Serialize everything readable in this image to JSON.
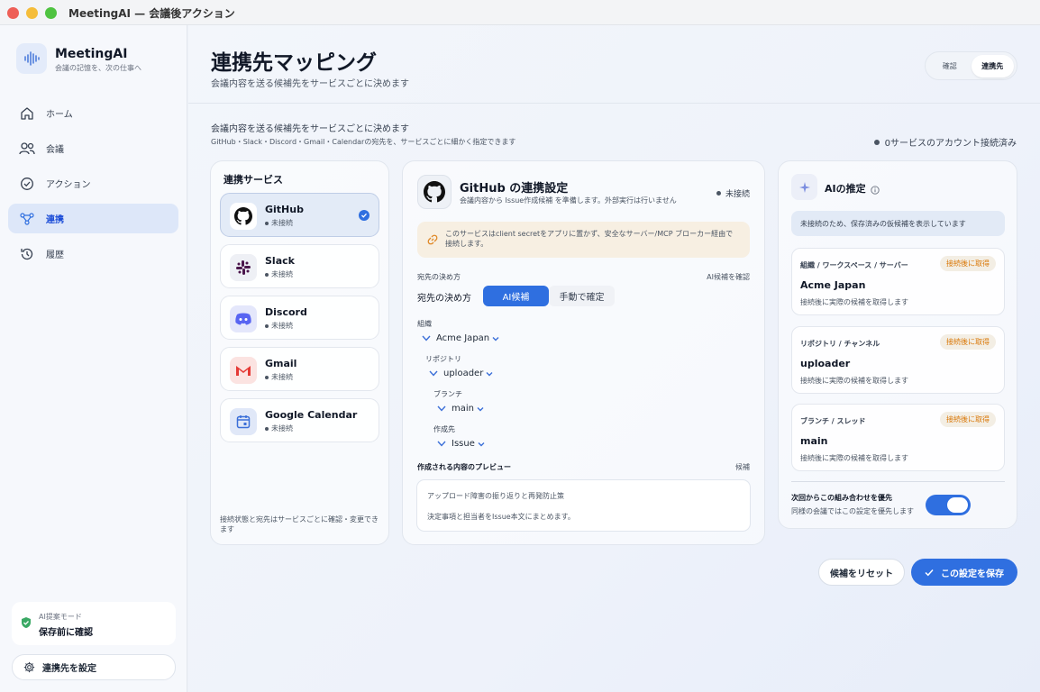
{
  "window": {
    "title": "MeetingAI — 会議後アクション"
  },
  "sidebar": {
    "app_name": "MeetingAI",
    "app_tagline": "会議の記憶を、次の仕事へ",
    "nav": [
      {
        "label": "ホーム",
        "icon": "home-icon"
      },
      {
        "label": "会議",
        "icon": "people-icon"
      },
      {
        "label": "アクション",
        "icon": "check-circle-icon"
      },
      {
        "label": "連携",
        "icon": "link-nodes-icon"
      },
      {
        "label": "履歴",
        "icon": "history-icon"
      }
    ],
    "active_nav": "連携",
    "mode_label": "AI提案モード",
    "mode_value": "保存前に確認",
    "config_button": "連携先を設定"
  },
  "header": {
    "title": "連携先マッピング",
    "subtitle": "会議内容を送る候補先をサービスごとに決めます",
    "tabs": [
      "確認",
      "連携先"
    ],
    "active_tab": "連携先"
  },
  "section": {
    "title": "会議内容を送る候補先をサービスごとに決めます",
    "description": "GitHub・Slack・Discord・Gmail・Calendarの宛先を、サービスごとに細かく指定できます",
    "connection_count": "0サービスのアカウント接続済み"
  },
  "services": {
    "title": "連携サービス",
    "items": [
      {
        "name": "GitHub",
        "status": "未接続",
        "icon": "github-icon",
        "selected": true
      },
      {
        "name": "Slack",
        "status": "未接続",
        "icon": "slack-icon",
        "selected": false
      },
      {
        "name": "Discord",
        "status": "未接続",
        "icon": "discord-icon",
        "selected": false
      },
      {
        "name": "Gmail",
        "status": "未接続",
        "icon": "gmail-icon",
        "selected": false
      },
      {
        "name": "Google Calendar",
        "status": "未接続",
        "icon": "calendar-icon",
        "selected": false
      }
    ],
    "footer": "接続状態と宛先はサービスごとに確認・変更できます"
  },
  "config": {
    "title": "GitHub の連携設定",
    "subtitle": "会議内容から Issue作成候補 を準備します。外部実行は行いません",
    "state": "未接続",
    "warning": "このサービスはclient secretをアプリに置かず、安全なサーバー/MCP ブローカー経由で接続します。",
    "dest_section_label": "宛先の決め方",
    "dest_section_right": "AI候補を確認",
    "dest_row_label": "宛先の決め方",
    "mode_ai": "AI候補",
    "mode_manual": "手動で確定",
    "org_label": "組織",
    "org_value": "Acme Japan",
    "repo_label": "リポジトリ",
    "repo_value": "uploader",
    "branch_label": "ブランチ",
    "branch_value": "main",
    "target_label": "作成先",
    "target_value": "Issue",
    "preview_title": "作成される内容のプレビュー",
    "preview_right": "候補",
    "preview_line1": "アップロード障害の振り返りと再発防止策",
    "preview_line2": "決定事項と担当者をIssue本文にまとめます。"
  },
  "ai": {
    "title": "AIの推定",
    "note": "未接続のため、保存済みの仮候補を表示しています",
    "candidates": [
      {
        "label": "組織 / ワークスペース / サーバー",
        "badge": "接続後に取得",
        "value": "Acme Japan",
        "note": "接続後に実際の候補を取得します"
      },
      {
        "label": "リポジトリ / チャンネル",
        "badge": "接続後に取得",
        "value": "uploader",
        "note": "接続後に実際の候補を取得します"
      },
      {
        "label": "ブランチ / スレッド",
        "badge": "接続後に取得",
        "value": "main",
        "note": "接続後に実際の候補を取得します"
      }
    ],
    "prioritize_title": "次回からこの組み合わせを優先",
    "prioritize_sub": "同様の会議ではこの設定を優先します",
    "prioritize_on": true
  },
  "actions": {
    "reset": "候補をリセット",
    "save": "この設定を保存"
  },
  "colors": {
    "accent": "#2f6fe0",
    "warning_badge": "#d97706",
    "gmail_red": "#e53935",
    "slack_purple": "#4a154b",
    "discord_blurple": "#5865f2"
  }
}
